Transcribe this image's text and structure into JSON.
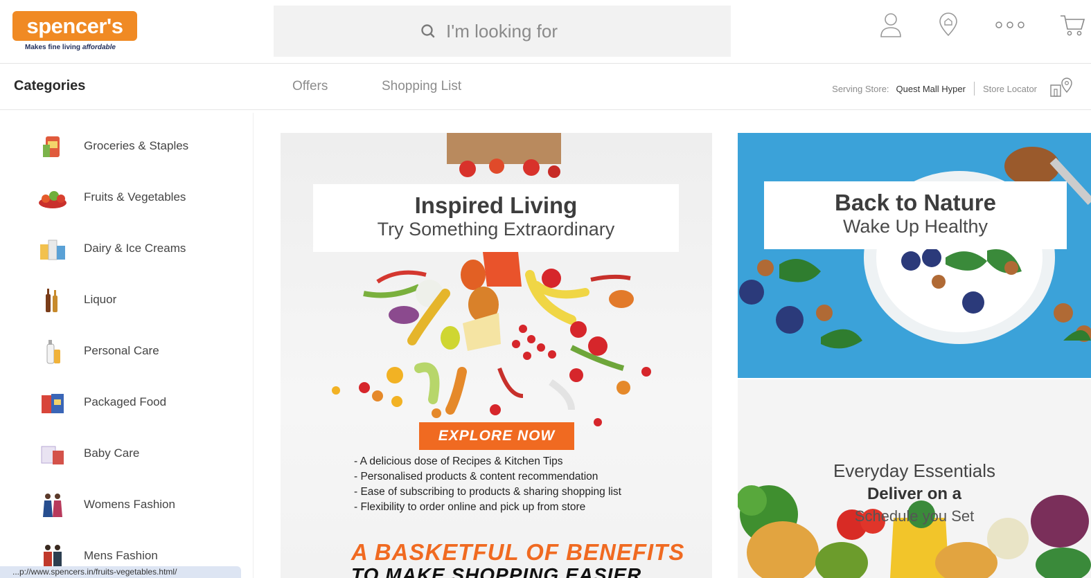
{
  "brand": {
    "name": "spencer's",
    "tagline_a": "Makes fine living ",
    "tagline_b": "affordable",
    "accent": "#f08a24",
    "navy": "#1f2d5a"
  },
  "search": {
    "placeholder": "I'm looking for",
    "icon": "search-icon"
  },
  "header_icons": [
    "user-icon",
    "location-icon",
    "more-icon",
    "cart-icon"
  ],
  "nav": {
    "categories_title": "Categories",
    "offers": "Offers",
    "shopping_list": "Shopping List",
    "serving_label": "Serving Store:",
    "store_name": "Quest Mall Hyper",
    "store_locator": "Store Locator"
  },
  "categories": [
    {
      "label": "Groceries & Staples"
    },
    {
      "label": "Fruits & Vegetables"
    },
    {
      "label": "Dairy & Ice Creams"
    },
    {
      "label": "Liquor"
    },
    {
      "label": "Personal Care"
    },
    {
      "label": "Packaged Food"
    },
    {
      "label": "Baby Care"
    },
    {
      "label": "Womens Fashion"
    },
    {
      "label": "Mens Fashion"
    }
  ],
  "banner_inspired": {
    "title": "Inspired Living",
    "subtitle": "Try Something Extraordinary",
    "cta": "EXPLORE NOW",
    "benefits": [
      "- A delicious dose of Recipes & Kitchen Tips",
      "- Personalised products & content recommendation",
      "- Ease of subscribing to products & sharing shopping list",
      "- Flexibility to order online and pick up from store"
    ],
    "headline": "A BASKETFUL OF BENEFITS",
    "headline2": "TO MAKE SHOPPING EASIER"
  },
  "banner_nature": {
    "title": "Back to Nature",
    "subtitle": "Wake Up Healthy"
  },
  "banner_essentials": {
    "title": "Everyday Essentials",
    "bold": "Deliver on a",
    "sub": "Schedule you Set"
  },
  "status_url": "...p://www.spencers.in/fruits-vegetables.html/"
}
